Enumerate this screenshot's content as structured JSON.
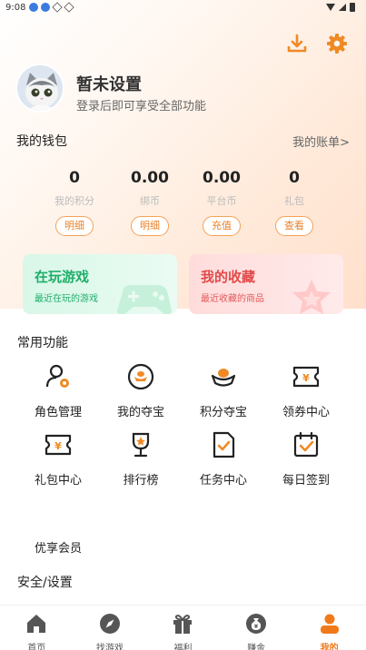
{
  "status_bar": {
    "time": "9:08"
  },
  "profile": {
    "name": "暂未设置",
    "subtitle": "登录后即可享受全部功能"
  },
  "wallet": {
    "title": "我的钱包",
    "bill_link": "我的账单>",
    "items": [
      {
        "value": "0",
        "label": "我的积分",
        "button": "明细"
      },
      {
        "value": "0.00",
        "label": "绑币",
        "button": "明细"
      },
      {
        "value": "0.00",
        "label": "平台币",
        "button": "充值"
      },
      {
        "value": "0",
        "label": "礼包",
        "button": "查看"
      }
    ]
  },
  "cards": [
    {
      "title": "在玩游戏",
      "subtitle": "最近在玩的游戏",
      "color": "#1fae6a"
    },
    {
      "title": "我的收藏",
      "subtitle": "最近收藏的商品",
      "color": "#e24a4a"
    }
  ],
  "features": {
    "title": "常用功能",
    "items": [
      {
        "label": "角色管理",
        "icon": "user-gear-icon"
      },
      {
        "label": "我的夺宝",
        "icon": "treasure-icon"
      },
      {
        "label": "积分夺宝",
        "icon": "gold-ingot-icon"
      },
      {
        "label": "领券中心",
        "icon": "coupon-icon"
      },
      {
        "label": "礼包中心",
        "icon": "gift-coupon-icon"
      },
      {
        "label": "排行榜",
        "icon": "trophy-icon"
      },
      {
        "label": "任务中心",
        "icon": "task-icon"
      },
      {
        "label": "每日签到",
        "icon": "calendar-check-icon"
      }
    ]
  },
  "vip": {
    "label": "优享会员"
  },
  "security": {
    "title": "安全/设置"
  },
  "nav": {
    "items": [
      {
        "label": "首页",
        "icon": "home-icon"
      },
      {
        "label": "找游戏",
        "icon": "compass-icon"
      },
      {
        "label": "福利",
        "icon": "gift-icon"
      },
      {
        "label": "赚金",
        "icon": "money-bag-icon"
      },
      {
        "label": "我的",
        "icon": "user-icon"
      }
    ],
    "active_color": "#f07a1a"
  },
  "accent_color": "#f08a24"
}
